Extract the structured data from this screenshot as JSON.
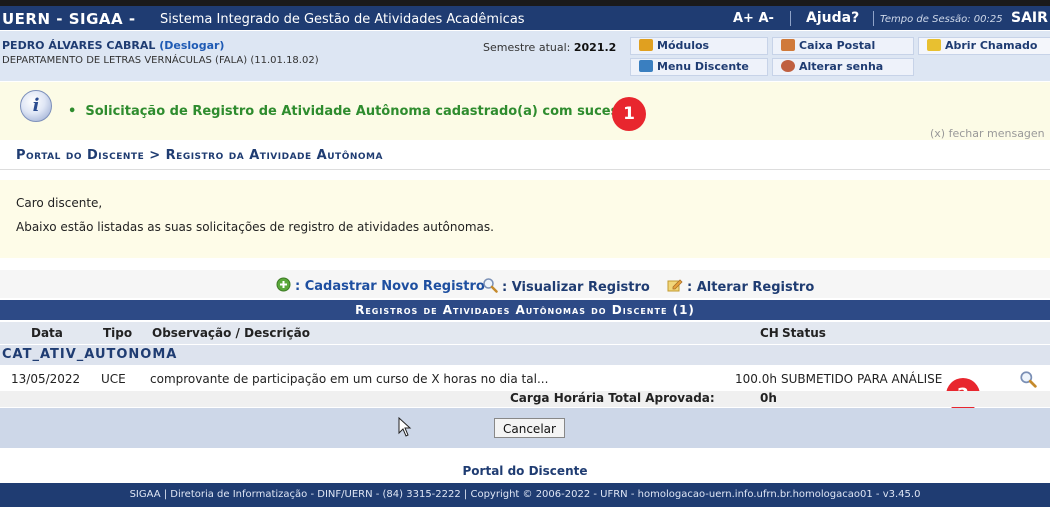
{
  "topbar": {
    "brand": "UERN - SIGAA -",
    "system_name": "Sistema Integrado de Gestão de Atividades Acadêmicas",
    "font_controls": "A+ A-",
    "help": "Ajuda?",
    "session": "Tempo de Sessão: 00:25",
    "logout": "SAIR"
  },
  "user": {
    "name": "PEDRO ÁLVARES CABRAL",
    "logout_link": "(Deslogar)",
    "department": "DEPARTAMENTO DE LETRAS VERNÁCULAS (FALA) (11.01.18.02)",
    "semester_label": "Semestre atual:",
    "semester_value": "2021.2"
  },
  "quick_links": {
    "modulos": "Módulos",
    "caixa_postal": "Caixa Postal",
    "abrir_chamado": "Abrir Chamado",
    "menu_discente": "Menu Discente",
    "alterar_senha": "Alterar senha"
  },
  "message": {
    "text": "Solicitação de Registro de Atividade Autônoma cadastrado(a) com sucesso!",
    "close": "(x) fechar mensagen",
    "badge1": "1",
    "badge2": "2"
  },
  "breadcrumb": "Portal do Discente > Registro da Atividade Autônoma",
  "notice": {
    "line1": "Caro discente,",
    "line2": "Abaixo estão listadas as suas solicitações de registro de atividades autônomas."
  },
  "legend": {
    "new": ": Cadastrar Novo Registro",
    "view": ": Visualizar Registro",
    "edit": ": Alterar Registro"
  },
  "table": {
    "title": "Registros de Atividades Autônomas do Discente (1)",
    "columns": {
      "data": "Data",
      "tipo": "Tipo",
      "obs": "Observação / Descrição",
      "ch": "CH",
      "status": "Status"
    },
    "group": "CAT_ATIV_AUTONOMA",
    "rows": [
      {
        "data": "13/05/2022",
        "tipo": "UCE",
        "obs": "comprovante de participação em um curso de X horas no dia tal...",
        "ch": "100.0h",
        "status": "SUBMETIDO PARA ANÁLISE"
      }
    ],
    "total_label": "Carga Horária Total Aprovada:",
    "total_value": "0h",
    "cancel": "Cancelar"
  },
  "portal_link": "Portal do Discente",
  "footer": "SIGAA | Diretoria de Informatização - DINF/UERN - (84) 3315-2222 | Copyright © 2006-2022 - UFRN - homologacao-uern.info.ufrn.br.homologacao01 - v3.45.0"
}
